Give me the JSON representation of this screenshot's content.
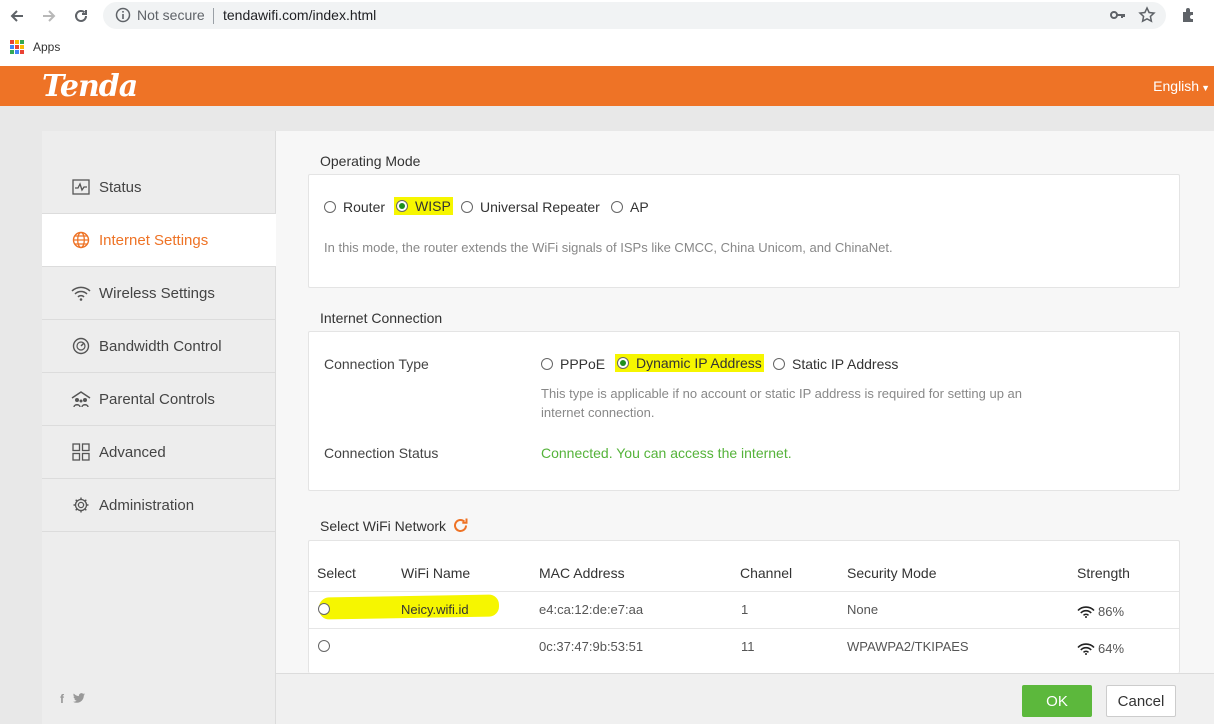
{
  "browser": {
    "not_secure": "Not secure",
    "url": "tendawifi.com/index.html",
    "bookmark_apps": "Apps"
  },
  "header": {
    "logo": "Tenda",
    "language": "English"
  },
  "sidebar": {
    "items": [
      {
        "label": "Status",
        "icon": "pulse-icon",
        "active": false
      },
      {
        "label": "Internet Settings",
        "icon": "globe-icon",
        "active": true
      },
      {
        "label": "Wireless Settings",
        "icon": "wifi-icon",
        "active": false
      },
      {
        "label": "Bandwidth Control",
        "icon": "gauge-icon",
        "active": false
      },
      {
        "label": "Parental Controls",
        "icon": "family-icon",
        "active": false
      },
      {
        "label": "Advanced",
        "icon": "grid-icon",
        "active": false
      },
      {
        "label": "Administration",
        "icon": "gear-icon",
        "active": false
      }
    ],
    "social": "f  🐦"
  },
  "operating_mode": {
    "title": "Operating Mode",
    "options": [
      "Router",
      "WISP",
      "Universal Repeater",
      "AP"
    ],
    "selected": "WISP",
    "description": "In this mode, the router extends the WiFi signals of ISPs like CMCC, China Unicom, and ChinaNet."
  },
  "internet_connection": {
    "title": "Internet Connection",
    "type_label": "Connection Type",
    "options": [
      "PPPoE",
      "Dynamic IP Address",
      "Static IP Address"
    ],
    "selected": "Dynamic IP Address",
    "hint_line1": "This type is applicable if no account or static IP address is required for setting up an",
    "hint_line2": "internet connection.",
    "status_label": "Connection Status",
    "status_value": "Connected. You can access the internet."
  },
  "wifi_network": {
    "title": "Select WiFi Network",
    "columns": [
      "Select",
      "WiFi Name",
      "MAC Address",
      "Channel",
      "Security Mode",
      "Strength"
    ],
    "rows": [
      {
        "name": "Neicy.wifi.id",
        "mac": "e4:ca:12:de:e7:aa",
        "channel": "1",
        "security": "None",
        "strength": "86%"
      },
      {
        "name": "",
        "mac": "0c:37:47:9b:53:51",
        "channel": "11",
        "security": "WPAWPA2/TKIPAES",
        "strength": "64%"
      }
    ]
  },
  "footer": {
    "ok": "OK",
    "cancel": "Cancel"
  },
  "colors": {
    "brand_orange": "#ee7326",
    "ok_green": "#5cb83c",
    "status_green": "#55b33a",
    "highlight_yellow": "#f6f600"
  }
}
